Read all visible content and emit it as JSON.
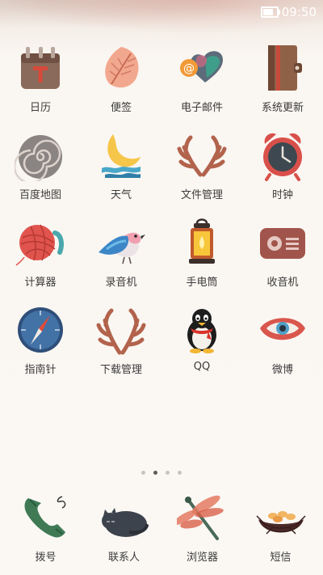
{
  "status": {
    "time": "09:50",
    "battery_level": 0.9
  },
  "pager": {
    "count": 4,
    "active": 1
  },
  "apps": [
    {
      "id": "calendar",
      "label": "日历",
      "icon": "calendar-icon"
    },
    {
      "id": "notes",
      "label": "便签",
      "icon": "leaf-note-icon"
    },
    {
      "id": "email",
      "label": "电子邮件",
      "icon": "email-heart-icon"
    },
    {
      "id": "system-update",
      "label": "系统更新",
      "icon": "notebook-icon"
    },
    {
      "id": "baidu-map",
      "label": "百度地图",
      "icon": "spiral-map-icon"
    },
    {
      "id": "weather",
      "label": "天气",
      "icon": "moon-weather-icon"
    },
    {
      "id": "file-manager",
      "label": "文件管理",
      "icon": "antler-icon"
    },
    {
      "id": "clock",
      "label": "时钟",
      "icon": "alarm-clock-icon"
    },
    {
      "id": "calculator",
      "label": "计算器",
      "icon": "yarn-ball-icon"
    },
    {
      "id": "recorder",
      "label": "录音机",
      "icon": "bird-icon"
    },
    {
      "id": "flashlight",
      "label": "手电筒",
      "icon": "lantern-icon"
    },
    {
      "id": "radio",
      "label": "收音机",
      "icon": "radio-icon"
    },
    {
      "id": "compass",
      "label": "指南针",
      "icon": "compass-icon"
    },
    {
      "id": "download-manager",
      "label": "下载管理",
      "icon": "antler-icon"
    },
    {
      "id": "qq",
      "label": "QQ",
      "icon": "penguin-icon"
    },
    {
      "id": "weibo",
      "label": "微博",
      "icon": "eye-lips-icon"
    }
  ],
  "dock": [
    {
      "id": "dialer",
      "label": "拨号",
      "icon": "phone-handset-icon"
    },
    {
      "id": "contacts",
      "label": "联系人",
      "icon": "sleeping-cat-icon"
    },
    {
      "id": "browser",
      "label": "浏览器",
      "icon": "dragonfly-icon"
    },
    {
      "id": "messages",
      "label": "短信",
      "icon": "bird-nest-icon"
    }
  ]
}
